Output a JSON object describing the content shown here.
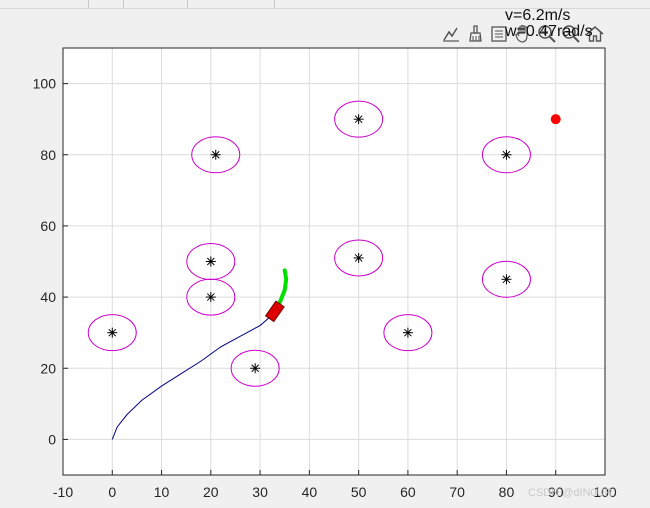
{
  "window": {
    "background": "#f0f0f0"
  },
  "readout": {
    "line1": "v=6.2m/s",
    "line2": "w=0.47rad/s"
  },
  "toolbar": {
    "items": [
      {
        "name": "data-tips-icon"
      },
      {
        "name": "brush-icon"
      },
      {
        "name": "datatip-icon"
      },
      {
        "name": "pan-icon"
      },
      {
        "name": "zoom-in-icon"
      },
      {
        "name": "zoom-out-icon"
      },
      {
        "name": "home-icon"
      }
    ]
  },
  "chart_data": {
    "type": "scatter",
    "xlim": [
      -10,
      100
    ],
    "ylim": [
      -10,
      110
    ],
    "xticks": [
      -10,
      0,
      10,
      20,
      30,
      40,
      50,
      60,
      70,
      80,
      90,
      100
    ],
    "yticks": [
      0,
      20,
      40,
      60,
      80,
      100
    ],
    "grid": true,
    "obstacles": [
      {
        "x": 0,
        "y": 30
      },
      {
        "x": 21,
        "y": 80
      },
      {
        "x": 20,
        "y": 50
      },
      {
        "x": 20,
        "y": 40
      },
      {
        "x": 29,
        "y": 20
      },
      {
        "x": 50,
        "y": 90
      },
      {
        "x": 50,
        "y": 51
      },
      {
        "x": 60,
        "y": 30
      },
      {
        "x": 80,
        "y": 80
      },
      {
        "x": 80,
        "y": 45
      }
    ],
    "obstacle_color": "#cc00cc",
    "goal": {
      "x": 90,
      "y": 90,
      "color": "#ff0000"
    },
    "path": {
      "color": "#00007f",
      "points": [
        [
          0,
          0
        ],
        [
          1,
          3.5
        ],
        [
          3,
          7
        ],
        [
          6,
          11
        ],
        [
          10,
          15
        ],
        [
          14,
          18.5
        ],
        [
          18,
          22
        ],
        [
          22,
          26
        ],
        [
          26,
          29
        ],
        [
          30,
          32
        ],
        [
          32.5,
          35
        ]
      ]
    },
    "predicted": {
      "color": "#00e000",
      "points": [
        [
          33,
          36
        ],
        [
          34,
          38.5
        ],
        [
          35,
          42
        ],
        [
          35.3,
          45
        ],
        [
          35,
          47.5
        ]
      ]
    },
    "robot": {
      "x": 33,
      "y": 36,
      "color": "#dd0000"
    }
  },
  "watermark": "CSDN @dIN0UR"
}
